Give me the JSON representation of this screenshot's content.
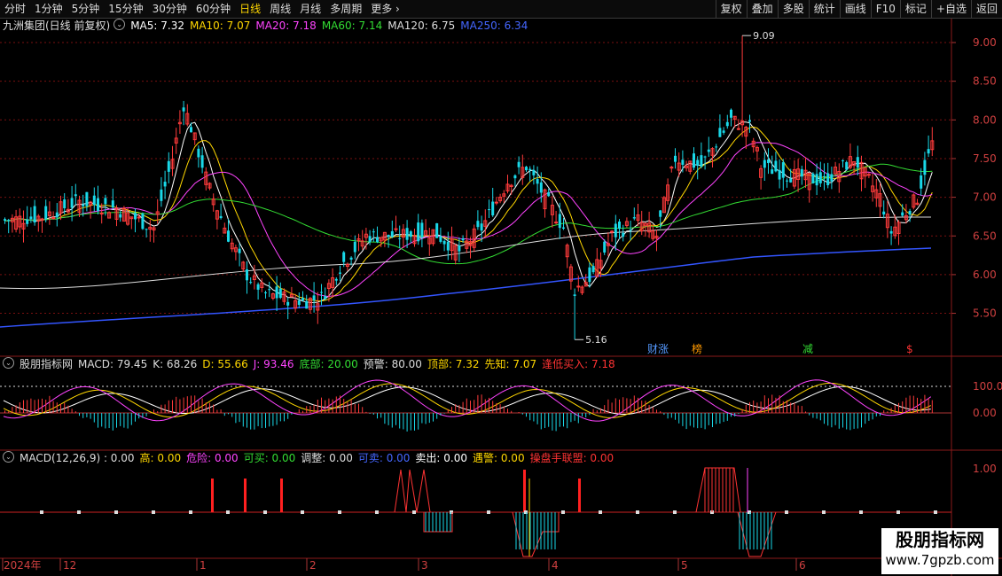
{
  "toolbar": {
    "periods": [
      "分时",
      "1分钟",
      "5分钟",
      "15分钟",
      "30分钟",
      "60分钟",
      "日线",
      "周线",
      "月线",
      "多周期",
      "更多"
    ],
    "active_index": 6,
    "more_arrow": "›",
    "right_buttons": [
      "复权",
      "叠加",
      "多股",
      "统计",
      "画线",
      "F10",
      "标记",
      "+自选",
      "返回"
    ]
  },
  "main_legend": {
    "title": "九洲集团(日线 前复权)",
    "items": [
      {
        "label": "MA5: 7.32",
        "color": "#ffffff"
      },
      {
        "label": "MA10: 7.07",
        "color": "#ffd700"
      },
      {
        "label": "MA20: 7.18",
        "color": "#ff44ff"
      },
      {
        "label": "MA60: 7.14",
        "color": "#33dd33"
      },
      {
        "label": "MA120: 6.75",
        "color": "#dddddd"
      },
      {
        "label": "MA250: 6.34",
        "color": "#4466ff"
      }
    ],
    "price_high": "9.09",
    "price_low": "5.16",
    "markers": [
      {
        "text": "财涨",
        "color": "#5599ff"
      },
      {
        "text": "榜",
        "color": "#ff9900"
      },
      {
        "text": "减",
        "color": "#33dd33"
      },
      {
        "text": "$",
        "color": "#ff3333"
      }
    ]
  },
  "price_axis": [
    "9.00",
    "8.50",
    "8.00",
    "7.50",
    "7.00",
    "6.50",
    "6.00",
    "5.50"
  ],
  "ind1_legend": {
    "title": "股朋指标网",
    "items": [
      {
        "label": "MACD: 79.45",
        "color": "#dddddd"
      },
      {
        "label": "K: 68.26",
        "color": "#dddddd"
      },
      {
        "label": "D: 55.66",
        "color": "#ffd700"
      },
      {
        "label": "J: 93.46",
        "color": "#ff44ff"
      },
      {
        "label": "底部: 20.00",
        "color": "#33dd33"
      },
      {
        "label": "预警: 80.00",
        "color": "#dddddd"
      },
      {
        "label": "顶部: 7.32",
        "color": "#ffd700"
      },
      {
        "label": "先知: 7.07",
        "color": "#ffd700"
      },
      {
        "label": "逢低买入: 7.18",
        "color": "#ff3333"
      }
    ]
  },
  "ind1_axis": [
    "100.0",
    "0.00"
  ],
  "ind2_legend": {
    "title": "MACD(12,26,9) : 0.00",
    "items": [
      {
        "label": "高: 0.00",
        "color": "#ffd700"
      },
      {
        "label": "危险: 0.00",
        "color": "#ff44ff"
      },
      {
        "label": "可买: 0.00",
        "color": "#33dd33"
      },
      {
        "label": "调整: 0.00",
        "color": "#dddddd"
      },
      {
        "label": "可卖: 0.00",
        "color": "#4466ff"
      },
      {
        "label": "卖出: 0.00",
        "color": "#ffffff"
      },
      {
        "label": "遇警: 0.00",
        "color": "#ffd700"
      },
      {
        "label": "操盘手联盟: 0.00",
        "color": "#ff3333"
      }
    ]
  },
  "ind2_axis": [
    "1.00"
  ],
  "time_axis": [
    "2024年",
    "12",
    "1",
    "2",
    "3",
    "4",
    "5",
    "6"
  ],
  "watermark": {
    "title": "股朋指标网",
    "url": "www.7gpzb.com"
  },
  "colors": {
    "up": "#ff3b3b",
    "down": "#19d8e8",
    "grid": "#7a1010"
  }
}
